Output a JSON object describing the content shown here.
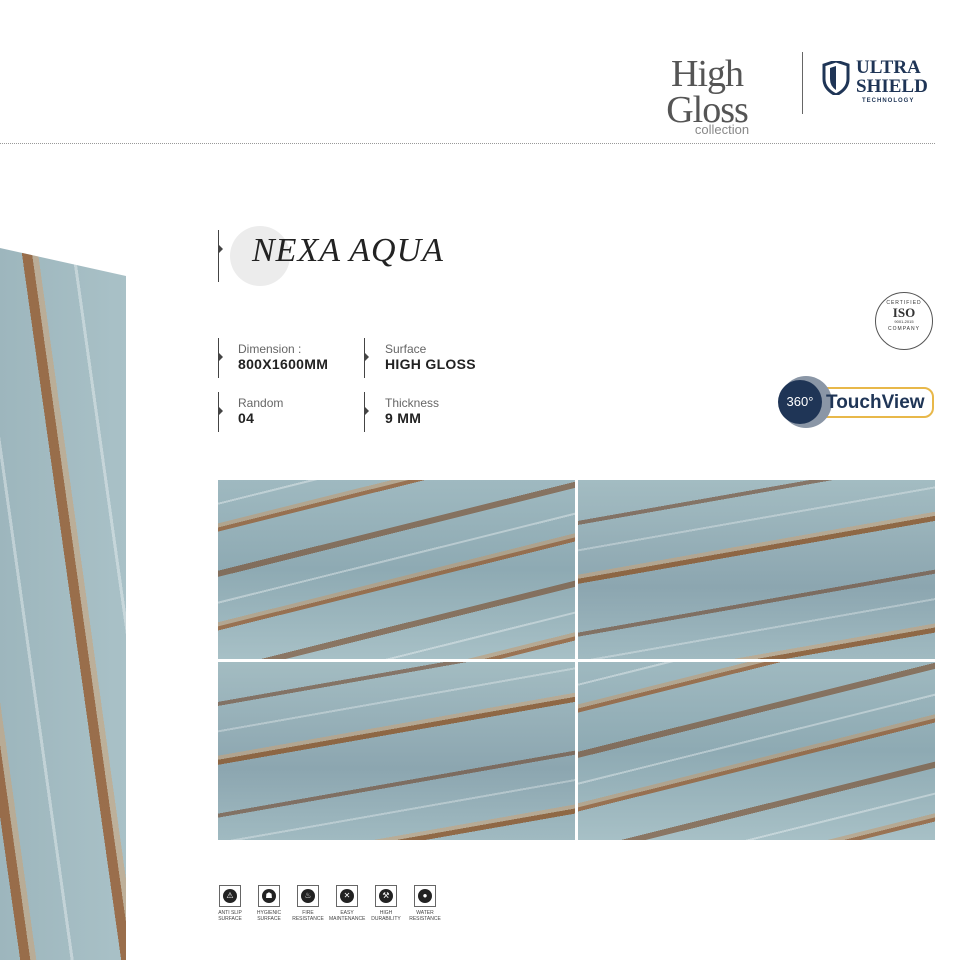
{
  "header": {
    "logo1_main": "High Gloss",
    "logo1_sub": "collection",
    "logo2_line1": "ULTRA",
    "logo2_line2": "SHIELD",
    "logo2_line3": "TECHNOLOGY"
  },
  "product": {
    "title": "NEXA AQUA"
  },
  "specs": [
    {
      "label": "Dimension :",
      "value": "800X1600MM"
    },
    {
      "label": "Surface",
      "value": "HIGH GLOSS"
    },
    {
      "label": "Random",
      "value": "04"
    },
    {
      "label": "Thickness",
      "value": "9 MM"
    }
  ],
  "badges": {
    "iso_top": "CERTIFIED",
    "iso_main": "ISO",
    "iso_num": "9001-2015",
    "iso_bottom": "COMPANY",
    "touch_360": "360°",
    "touch_label": "TouchView"
  },
  "features": [
    {
      "line1": "ANTI SLIP",
      "line2": "SURFACE",
      "icon": "anti-slip-icon"
    },
    {
      "line1": "HYGIENIC",
      "line2": "SURFACE",
      "icon": "hygienic-icon"
    },
    {
      "line1": "FIRE",
      "line2": "RESISTANCE",
      "icon": "fire-icon"
    },
    {
      "line1": "EASY",
      "line2": "MAINTENANCE",
      "icon": "tools-icon"
    },
    {
      "line1": "HIGH",
      "line2": "DURABILITY",
      "icon": "durability-icon"
    },
    {
      "line1": "WATER",
      "line2": "RESISTANCE",
      "icon": "water-drop-icon"
    }
  ],
  "colors": {
    "navy": "#1f3556",
    "accent": "#e8b84a"
  }
}
